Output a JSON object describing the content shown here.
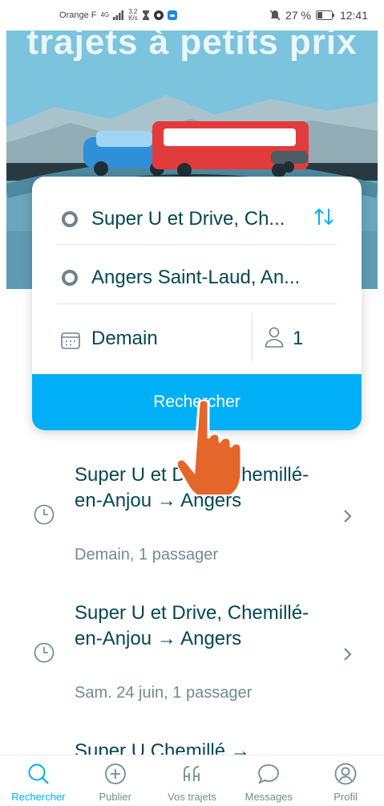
{
  "status_bar": {
    "carrier": "Orange F",
    "network": "4G",
    "speed_value": "3,2",
    "speed_unit": "K/s",
    "battery": "27 %",
    "time": "12:41"
  },
  "hero": {
    "title": "trajets à petits prix"
  },
  "search": {
    "from": "Super U et Drive, Ch...",
    "to": "Angers Saint-Laud, An...",
    "date": "Demain",
    "passengers": "1",
    "button_label": "Rechercher"
  },
  "recent": [
    {
      "title": "Super U et Drive, Chemillé-en-Anjou → Angers",
      "subtitle": "Demain, 1 passager"
    },
    {
      "title": "Super U et Drive, Chemillé-en-Anjou → Angers",
      "subtitle": "Sam. 24 juin, 1 passager"
    },
    {
      "title": "Super U Chemillé →",
      "subtitle": ""
    }
  ],
  "nav": {
    "search": "Rechercher",
    "publish": "Publier",
    "trips": "Vos trajets",
    "messages": "Messages",
    "profile": "Profil"
  },
  "colors": {
    "accent": "#00aff5",
    "text": "#054752",
    "muted": "#708c91",
    "hand": "#e4662b"
  }
}
